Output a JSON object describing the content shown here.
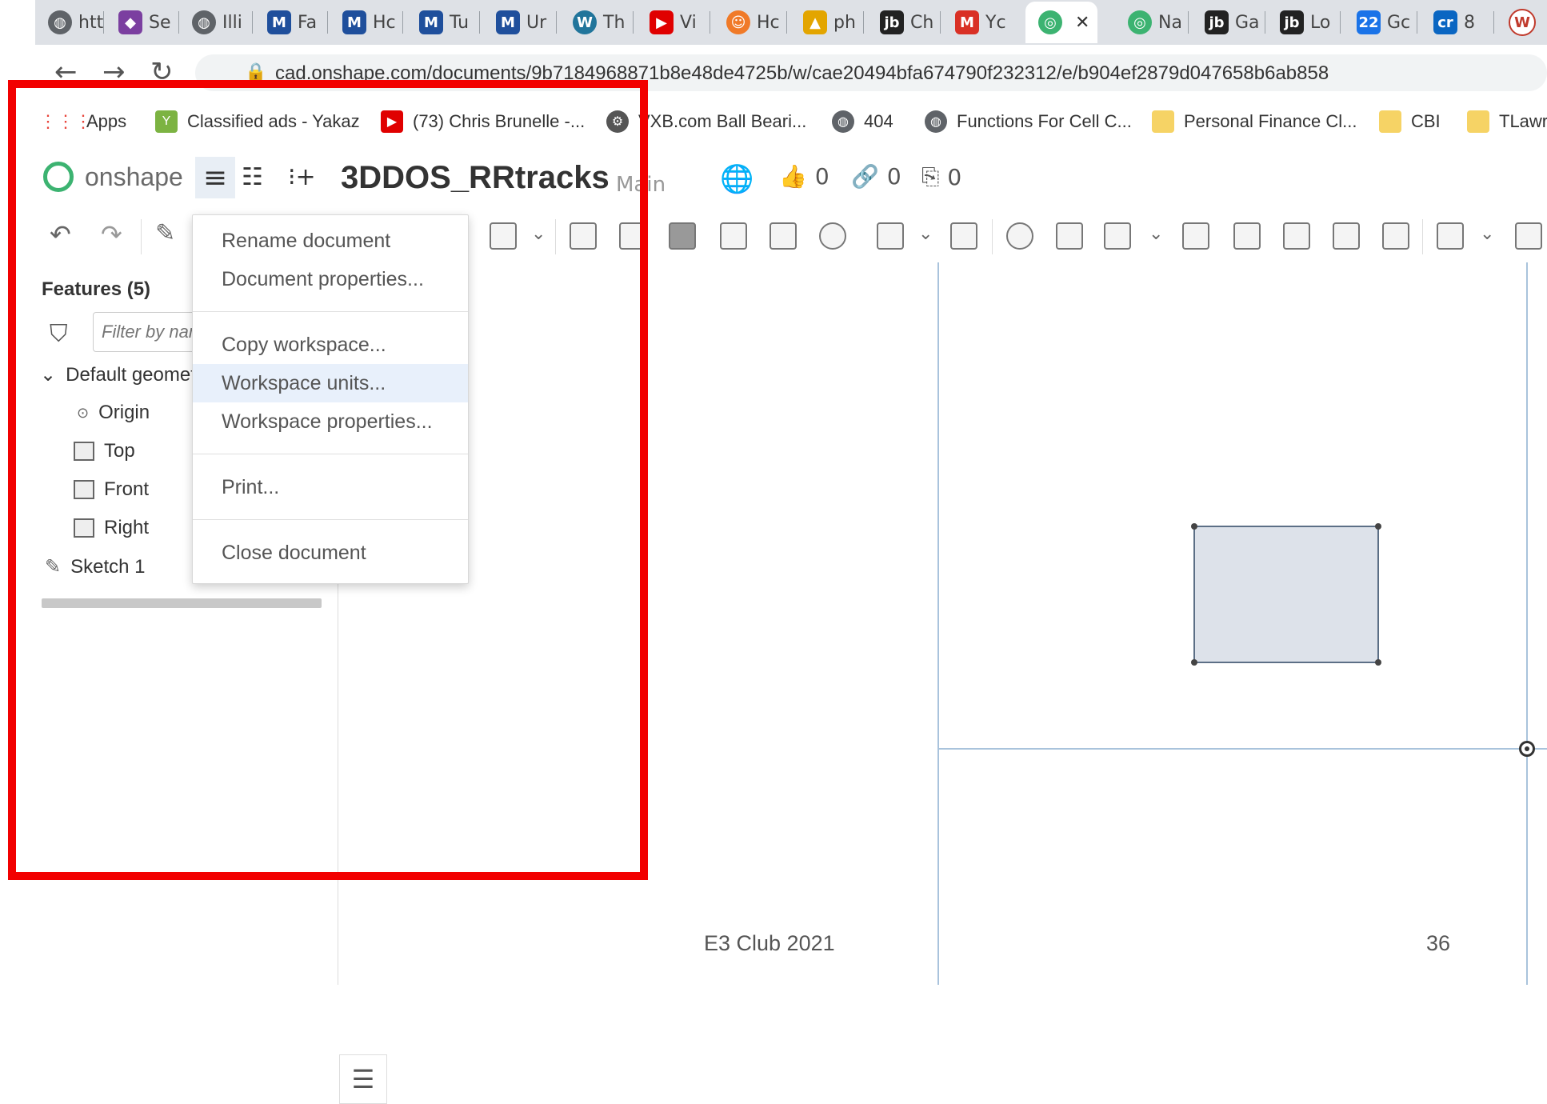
{
  "browser": {
    "tabs": [
      {
        "label": "htt",
        "icon": "globe-icon",
        "color": "#5f6368"
      },
      {
        "label": "Se",
        "icon": "diamond-icon",
        "color": "#7b3fa0"
      },
      {
        "label": "Illi",
        "icon": "globe-icon",
        "color": "#5f6368"
      },
      {
        "label": "Fa",
        "icon": "m-logo-icon",
        "color": "#1f4f9c"
      },
      {
        "label": "Hc",
        "icon": "m-logo-icon",
        "color": "#1f4f9c"
      },
      {
        "label": "Tu",
        "icon": "m-logo-icon",
        "color": "#1f4f9c"
      },
      {
        "label": "Ur",
        "icon": "m-logo-icon",
        "color": "#1f4f9c"
      },
      {
        "label": "Th",
        "icon": "wordpress-icon",
        "color": "#21759b"
      },
      {
        "label": "Vi",
        "icon": "youtube-icon",
        "color": "#e00000"
      },
      {
        "label": "Hc",
        "icon": "orange-circle-icon",
        "color": "#f07a28"
      },
      {
        "label": "ph",
        "icon": "pma-icon",
        "color": "#e3a500"
      },
      {
        "label": "Ch",
        "icon": "jb-icon",
        "color": "#222222"
      },
      {
        "label": "Yc",
        "icon": "gmail-icon",
        "color": "#d93025"
      },
      {
        "label": "",
        "icon": "onshape-icon",
        "color": "#3cb371",
        "active": true,
        "close": "✕"
      },
      {
        "label": "Na",
        "icon": "onshape-icon",
        "color": "#3cb371"
      },
      {
        "label": "Ga",
        "icon": "jb-icon",
        "color": "#222222"
      },
      {
        "label": "Lo",
        "icon": "jb-icon",
        "color": "#222222"
      },
      {
        "label": "Gc",
        "icon": "calendar-icon",
        "color": "#1a73e8"
      },
      {
        "label": "8",
        "icon": "cr-icon",
        "color": "#0a66c2"
      },
      {
        "label": "",
        "icon": "w-circle-icon",
        "color": "#c0392b"
      }
    ],
    "url": "cad.onshape.com/documents/9b7184968871b8e48de4725b/w/cae20494bfa674790f232312/e/b904ef2879d047658b6ab858",
    "bookmarks": [
      {
        "label": "Apps",
        "icon": "apps-grid-icon",
        "color": "#e8453c"
      },
      {
        "label": "Classified ads - Yakaz",
        "icon": "yakaz-icon",
        "color": "#7cb342"
      },
      {
        "label": "(73) Chris Brunelle -...",
        "icon": "youtube-icon",
        "color": "#e00000"
      },
      {
        "label": "VXB.com Ball Beari...",
        "icon": "gear-icon",
        "color": "#555555"
      },
      {
        "label": "404",
        "icon": "globe-icon",
        "color": "#5f6368"
      },
      {
        "label": "Functions For Cell C...",
        "icon": "globe-icon",
        "color": "#5f6368"
      },
      {
        "label": "Personal Finance Cl...",
        "icon": "folder-icon",
        "color": "#f6d365"
      },
      {
        "label": "CBI",
        "icon": "folder-icon",
        "color": "#f6d365"
      },
      {
        "label": "TLawr",
        "icon": "folder-icon",
        "color": "#f6d365"
      }
    ]
  },
  "header": {
    "brand": "onshape",
    "doc_title": "3DDOS_RRtracks",
    "workspace": "Main",
    "likes": "0",
    "links": "0",
    "copies": "0"
  },
  "menu": {
    "items": [
      {
        "label": "Rename document"
      },
      {
        "label": "Document properties..."
      },
      {
        "label": "Copy workspace..."
      },
      {
        "label": "Workspace units...",
        "highlighted": true
      },
      {
        "label": "Workspace properties..."
      },
      {
        "label": "Print..."
      },
      {
        "label": "Close document"
      }
    ]
  },
  "features": {
    "title": "Features (5)",
    "filter_placeholder": "Filter by name",
    "tree": [
      {
        "label": "Default geometry",
        "icon": "chevron-down-icon"
      },
      {
        "label": "Origin",
        "icon": "origin-icon"
      },
      {
        "label": "Top",
        "icon": "plane-icon"
      },
      {
        "label": "Front",
        "icon": "plane-icon"
      },
      {
        "label": "Right",
        "icon": "plane-icon"
      },
      {
        "label": "Sketch 1",
        "icon": "pencil-icon"
      }
    ]
  },
  "slide": {
    "footer": "E3 Club 2021",
    "page": "36",
    "highlight_color": "#f20000"
  }
}
